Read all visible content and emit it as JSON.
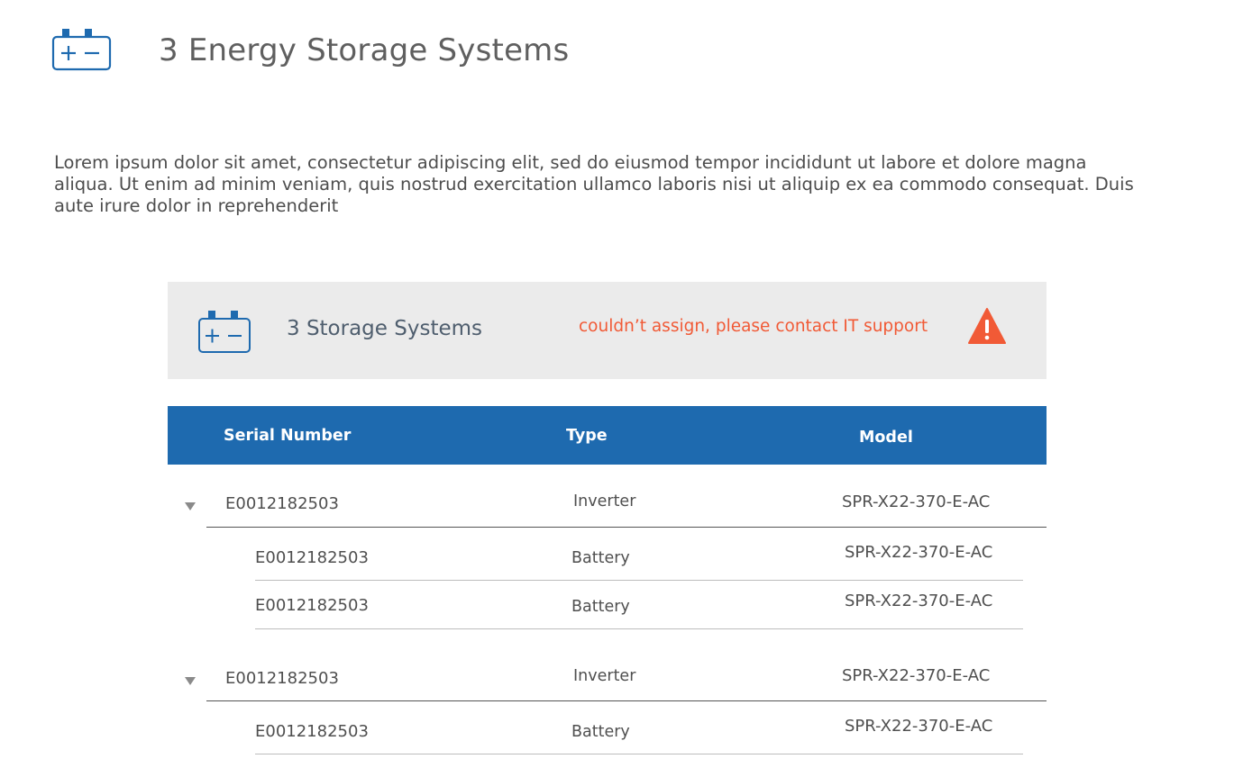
{
  "header": {
    "title": "3 Energy Storage Systems",
    "icon": "battery-icon",
    "intro": "Lorem ipsum dolor sit amet, consectetur adipiscing elit, sed do eiusmod tempor incididunt ut labore et dolore magna aliqua. Ut enim ad minim veniam, quis nostrud exercitation ullamco laboris nisi ut aliquip ex ea commodo consequat. Duis aute irure dolor in reprehenderit"
  },
  "panel": {
    "title": "3 Storage Systems",
    "icon": "battery-icon",
    "error": "couldn’t assign, please contact IT support",
    "warning_icon": "warning-icon"
  },
  "table": {
    "columns": [
      "Serial Number",
      "Type",
      "Model"
    ],
    "groups": [
      {
        "serial": "E0012182503",
        "type": "Inverter",
        "model": "SPR-X22-370-E-AC",
        "children": [
          {
            "serial": "E0012182503",
            "type": "Battery",
            "model": "SPR-X22-370-E-AC"
          },
          {
            "serial": "E0012182503",
            "type": "Battery",
            "model": "SPR-X22-370-E-AC"
          }
        ]
      },
      {
        "serial": "E0012182503",
        "type": "Inverter",
        "model": "SPR-X22-370-E-AC",
        "children": [
          {
            "serial": "E0012182503",
            "type": "Battery",
            "model": "SPR-X22-370-E-AC"
          }
        ]
      }
    ]
  },
  "colors": {
    "header_blue": "#1e6aaf",
    "icon_blue": "#1e6aaf",
    "error_orange": "#f15a36",
    "panel_bg": "#ebebeb"
  }
}
